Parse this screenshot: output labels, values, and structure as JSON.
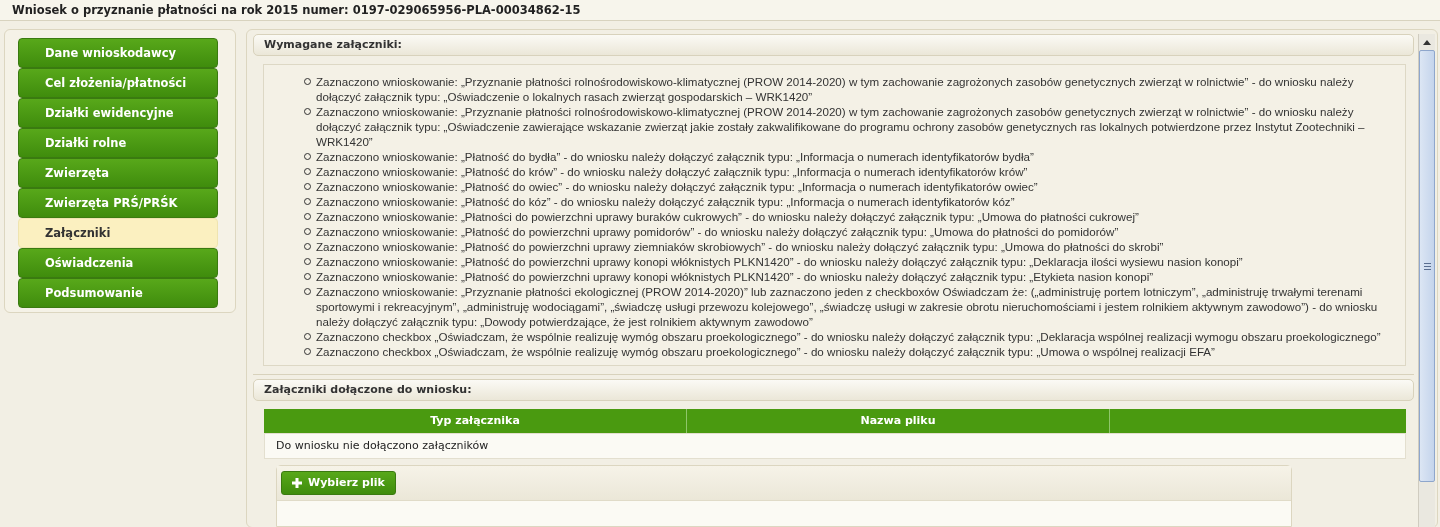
{
  "header": {
    "title": "Wniosek o przyznanie płatności na rok 2015 numer: 0197-029065956-PLA-00034862-15"
  },
  "sidebar": {
    "items": [
      {
        "label": "Dane wnioskodawcy",
        "selected": false
      },
      {
        "label": "Cel złożenia/płatności",
        "selected": false
      },
      {
        "label": "Działki ewidencyjne",
        "selected": false
      },
      {
        "label": "Działki rolne",
        "selected": false
      },
      {
        "label": "Zwierzęta",
        "selected": false
      },
      {
        "label": "Zwierzęta PRŚ/PRŚK",
        "selected": false
      },
      {
        "label": "Załączniki",
        "selected": true
      },
      {
        "label": "Oświadczenia",
        "selected": false
      },
      {
        "label": "Podsumowanie",
        "selected": false
      }
    ]
  },
  "required_section": {
    "title": "Wymagane załączniki:",
    "items": [
      "Zaznaczono wnioskowanie: „Przyznanie płatności rolnośrodowiskowo-klimatycznej (PROW 2014-2020) w tym zachowanie zagrożonych zasobów genetycznych zwierząt w rolnictwie” - do wniosku należy dołączyć załącznik typu: „Oświadczenie o lokalnych rasach zwierząt gospodarskich – WRK1420”",
      "Zaznaczono wnioskowanie: „Przyznanie płatności rolnośrodowiskowo-klimatycznej (PROW 2014-2020) w tym zachowanie zagrożonych zasobów genetycznych zwierząt w rolnictwie” - do wniosku należy dołączyć załącznik typu: „Oświadczenie zawierające wskazanie zwierząt jakie zostały zakwalifikowane do programu ochrony zasobów genetycznych ras lokalnych potwierdzone przez Instytut Zootechniki – WRK1420”",
      "Zaznaczono wnioskowanie: „Płatność do bydła” - do wniosku należy dołączyć załącznik typu: „Informacja o numerach identyfikatorów bydła”",
      "Zaznaczono wnioskowanie: „Płatność do krów” - do wniosku należy dołączyć załącznik typu: „Informacja o numerach identyfikatorów krów”",
      "Zaznaczono wnioskowanie: „Płatność do owiec” - do wniosku należy dołączyć załącznik typu: „Informacja o numerach identyfikatorów owiec”",
      "Zaznaczono wnioskowanie: „Płatność do kóz” - do wniosku należy dołączyć załącznik typu: „Informacja o numerach identyfikatorów kóz”",
      "Zaznaczono wnioskowanie: „Płatności do powierzchni uprawy buraków cukrowych” - do wniosku należy dołączyć załącznik typu: „Umowa do płatności cukrowej”",
      "Zaznaczono wnioskowanie: „Płatność do powierzchni uprawy pomidorów” - do wniosku należy dołączyć załącznik typu: „Umowa do płatności do pomidorów”",
      "Zaznaczono wnioskowanie: „Płatność do powierzchni uprawy ziemniaków skrobiowych” - do wniosku należy dołączyć załącznik typu: „Umowa do płatności do skrobi”",
      "Zaznaczono wnioskowanie: „Płatność do powierzchni uprawy konopi włóknistych PLKN1420” - do wniosku należy dołączyć załącznik typu: „Deklaracja ilości wysiewu nasion konopi”",
      "Zaznaczono wnioskowanie: „Płatność do powierzchni uprawy konopi włóknistych PLKN1420” - do wniosku należy dołączyć załącznik typu: „Etykieta nasion konopi”",
      "Zaznaczono wnioskowanie: „Przyznanie płatności ekologicznej (PROW 2014-2020)” lub zaznaczono jeden z checkboxów Oświadczam że: („administruję portem lotniczym”, „administruję trwałymi terenami sportowymi i rekreacyjnym”, „administruję wodociągami”, „świadczę usługi przewozu kolejowego”, „świadczę usługi w zakresie obrotu nieruchomościami i jestem rolnikiem aktywnym zawodowo”) - do wniosku należy dołączyć załącznik typu: „Dowody potwierdzające, że jest rolnikiem aktywnym zawodowo”",
      "Zaznaczono checkbox „Oświadczam, że wspólnie realizuję wymóg obszaru proekologicznego” - do wniosku należy dołączyć załącznik typu: „Deklaracja wspólnej realizacji wymogu obszaru proekologicznego”",
      "Zaznaczono checkbox „Oświadczam, że wspólnie realizuję wymóg obszaru proekologicznego” - do wniosku należy dołączyć załącznik typu: „Umowa o wspólnej realizacji EFA”"
    ]
  },
  "attached_section": {
    "title": "Załączniki dołączone do wniosku:",
    "table": {
      "columns": [
        "Typ załącznika",
        "Nazwa pliku"
      ],
      "empty_message": "Do wniosku nie dołączono załączników"
    },
    "upload_button": {
      "label": "Wybierz plik"
    }
  }
}
